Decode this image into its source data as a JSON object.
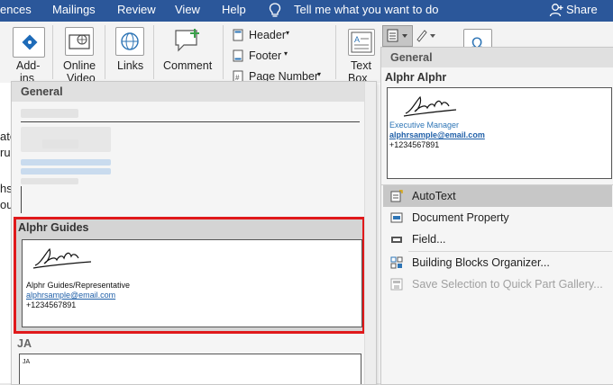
{
  "menubar": {
    "items": [
      "ences",
      "Mailings",
      "Review",
      "View",
      "Help"
    ],
    "tellme": "Tell me what you want to do",
    "share": "Share"
  },
  "ribbon": {
    "addins_label": "Add-",
    "addins_label2": "ins",
    "online_video_label": "Online",
    "online_video_label2": "Video",
    "links_label": "Links",
    "comment_label": "Comment",
    "header_label": "Header",
    "footer_label": "Footer",
    "page_number_label": "Page Number",
    "textbox_label": "Text",
    "textbox_label2": "Box"
  },
  "doc_fragments": [
    "ate",
    "ru",
    "hs",
    "ou"
  ],
  "gallery": {
    "section1_header": "General",
    "section2_header": "Alphr Guides",
    "section3_header": "JA",
    "alphr_guides_sig": {
      "title": "Alphr Guides/Representative",
      "email": "alphrsample@email.com",
      "phone": "+1234567891"
    },
    "ja_box_label": "JA"
  },
  "rpanel": {
    "header": "General",
    "entry_title": "Alphr Alphr",
    "entry_sig": {
      "title": "Executive Manager",
      "email": "alphrsample@email.com",
      "phone": "+1234567891"
    },
    "menu": [
      {
        "label": "AutoText",
        "icon": "autotext-icon"
      },
      {
        "label": "Document Property",
        "icon": "document-property-icon"
      },
      {
        "label": "Field...",
        "icon": "field-icon"
      },
      {
        "label": "Building Blocks Organizer...",
        "icon": "building-blocks-icon"
      },
      {
        "label": "Save Selection to Quick Part Gallery...",
        "icon": "save-selection-icon"
      }
    ]
  },
  "colors": {
    "menubar": "#2b579a",
    "selection_border": "#e0191b",
    "hover": "#c7c7c7",
    "link_blue": "#1f5fa8",
    "accent_blue": "#2e75b6"
  }
}
